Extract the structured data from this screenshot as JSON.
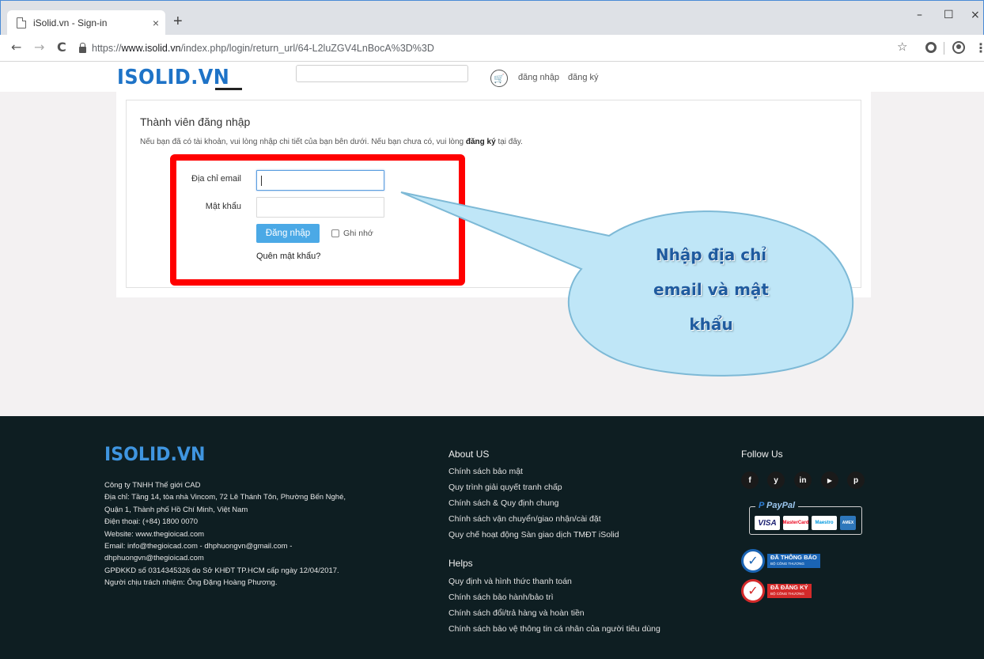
{
  "browser": {
    "tab_title": "iSolid.vn - Sign-in",
    "tab_close": "×",
    "new_tab": "+",
    "url_scheme": "https://",
    "url_host": "www.isolid.vn",
    "url_path": "/index.php/login/return_url/64-L2luZGV4LnBocA%3D%3D",
    "window_controls": {
      "minimize": "–",
      "maximize": "☐",
      "close": "×"
    },
    "nav": {
      "back": "←",
      "forward": "→",
      "reload": "C"
    }
  },
  "site_header": {
    "logo": "ISOLID.VN",
    "search_value": "",
    "login_link": "đăng nhập",
    "register_link": "đăng ký"
  },
  "login": {
    "title": "Thành viên đăng nhập",
    "desc_before": "Nếu bạn đã có tài khoản, vui lòng nhập chi tiết của bạn bên dưới. Nếu bạn chưa có, vui lòng ",
    "desc_link": "đăng ký",
    "desc_after": " tại đây.",
    "email_label": "Địa chỉ email",
    "email_value": "",
    "password_label": "Mật khẩu",
    "password_value": "",
    "submit_label": "Đăng nhập",
    "remember_label": "Ghi nhớ",
    "remember_checked": false,
    "forgot_link": "Quên mật khẩu?"
  },
  "callout": {
    "lines": [
      "Nhập địa chỉ",
      "email và mật",
      "khẩu"
    ],
    "fill_color": "#bfe6f7",
    "text_color": "#1f5b9f"
  },
  "annotation": {
    "frame_color": "#ff0000"
  },
  "footer": {
    "logo": "ISOLID.VN",
    "company_lines": [
      "Công ty TNHH Thế giới CAD",
      "Địa chỉ: Tầng 14, tòa nhà Vincom, 72 Lê Thánh Tôn, Phường Bến Nghé,",
      "Quận 1, Thành phố Hồ Chí Minh, Việt Nam",
      "Điện thoại: (+84) 1800 0070",
      "Website: www.thegioicad.com",
      "Email: info@thegioicad.com - dhphuongvn@gmail.com -",
      "dhphuongvn@thegioicad.com",
      "GPĐKKD số 0314345326 do Sở KHĐT TP.HCM cấp ngày 12/04/2017.",
      "Người chịu trách nhiệm: Ông Đặng Hoàng Phương."
    ],
    "about_title": "About US",
    "about_links": [
      "Chính sách bảo mật",
      "Quy trình giải quyết tranh chấp",
      "Chính sách & Quy định chung",
      "Chính sách vận chuyển/giao nhận/cài đặt",
      "Quy chế hoạt động Sàn giao dịch TMĐT iSolid"
    ],
    "helps_title": "Helps",
    "helps_links": [
      "Quy định và hình thức thanh toán",
      "Chính sách bảo hành/bảo trì",
      "Chính sách đổi/trả hàng và hoàn tiền",
      "Chính sách bảo vệ thông tin cá nhân của người tiêu dùng"
    ],
    "follow_title": "Follow Us",
    "social_icons": [
      "f",
      "y",
      "in",
      "▶",
      "p"
    ],
    "paypal_label": "PayPal",
    "payment_cards": [
      "VISA",
      "MasterCard",
      "Maestro",
      "AMEX"
    ],
    "badge_notified": {
      "title": "ĐÃ THÔNG BÁO",
      "sub": "BỘ CÔNG THƯƠNG",
      "color": "#1a64b4"
    },
    "badge_registered": {
      "title": "ĐÃ ĐĂNG KÝ",
      "sub": "BỘ CÔNG THƯƠNG",
      "color": "#d42a2a"
    }
  }
}
